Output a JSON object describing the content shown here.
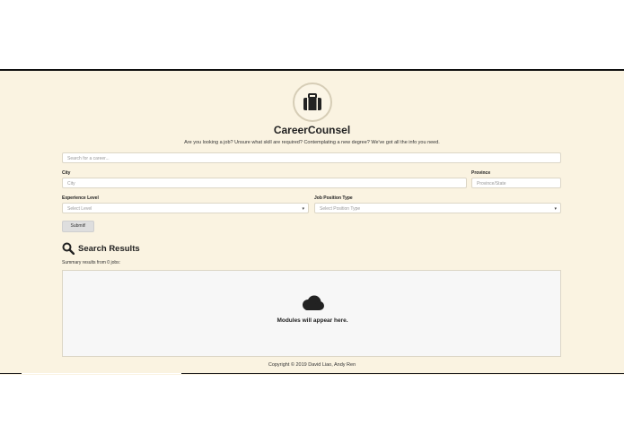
{
  "header": {
    "logo_icon": "briefcase-icon",
    "app_title": "CareerCounsel",
    "tagline": "Are you looking a job? Unsure what skill are required? Contemplating a new degree? We've got all the info you need."
  },
  "search": {
    "career_placeholder": "Search for a career..."
  },
  "city": {
    "label": "City",
    "placeholder": "City"
  },
  "province": {
    "label": "Province",
    "placeholder": "Province/State"
  },
  "experience": {
    "label": "Experience Level",
    "selected": "Select Level"
  },
  "position": {
    "label": "Job Position Type",
    "selected": "Select Position Type"
  },
  "submit_label": "Submit!",
  "results": {
    "icon": "search-icon",
    "title": "Search Results",
    "summary": "Summary results from 0 jobs:",
    "modules_icon": "cloud-icon",
    "modules_text": "Modules will appear here."
  },
  "footer": {
    "copyright": "Copyright © 2019 David Liao, Andy Ren"
  },
  "colors": {
    "background": "#faf3e1",
    "panel": "#f7f7f7",
    "text": "#222222"
  }
}
